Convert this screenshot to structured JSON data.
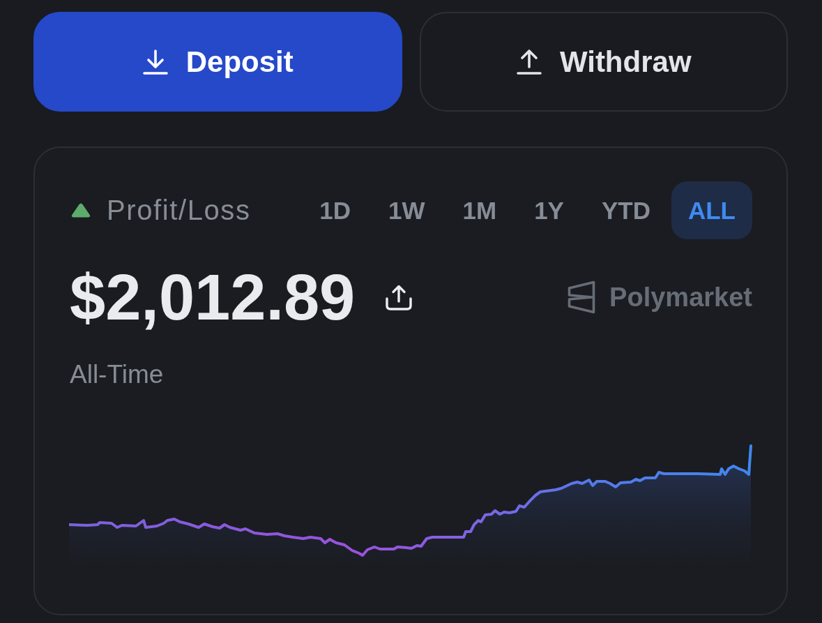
{
  "actions": [
    {
      "label": "Deposit",
      "kind": "deposit",
      "primary": true
    },
    {
      "label": "Withdraw",
      "kind": "withdraw",
      "primary": false
    }
  ],
  "pnl_card": {
    "trend_up": true,
    "title": "Profit/Loss",
    "ranges": [
      {
        "label": "1D",
        "selected": false
      },
      {
        "label": "1W",
        "selected": false
      },
      {
        "label": "1M",
        "selected": false
      },
      {
        "label": "1Y",
        "selected": false
      },
      {
        "label": "YTD",
        "selected": false
      },
      {
        "label": "ALL",
        "selected": true
      }
    ],
    "amount": "$2,012.89",
    "brand": "Polymarket",
    "period": "All-Time"
  }
}
